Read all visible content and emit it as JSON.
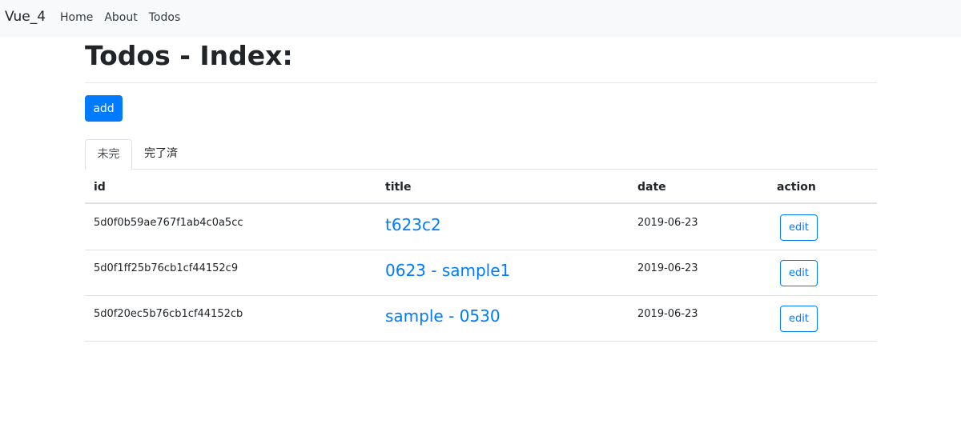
{
  "navbar": {
    "brand": "Vue_4",
    "links": [
      {
        "label": "Home"
      },
      {
        "label": "About"
      },
      {
        "label": "Todos"
      }
    ]
  },
  "page": {
    "title": "Todos - Index:",
    "add_label": "add"
  },
  "tabs": [
    {
      "label": "未完",
      "active": true
    },
    {
      "label": "完了済",
      "active": false
    }
  ],
  "table": {
    "headers": {
      "id": "id",
      "title": "title",
      "date": "date",
      "action": "action"
    },
    "rows": [
      {
        "id": "5d0f0b59ae767f1ab4c0a5cc",
        "title": "t623c2",
        "date": "2019-06-23",
        "action_label": "edit"
      },
      {
        "id": "5d0f1ff25b76cb1cf44152c9",
        "title": "0623 - sample1",
        "date": "2019-06-23",
        "action_label": "edit"
      },
      {
        "id": "5d0f20ec5b76cb1cf44152cb",
        "title": "sample - 0530",
        "date": "2019-06-23",
        "action_label": "edit"
      }
    ]
  },
  "colors": {
    "primary": "#007bff",
    "navbar_bg": "#f8f9fa",
    "border": "#dee2e6",
    "text": "#212529"
  }
}
